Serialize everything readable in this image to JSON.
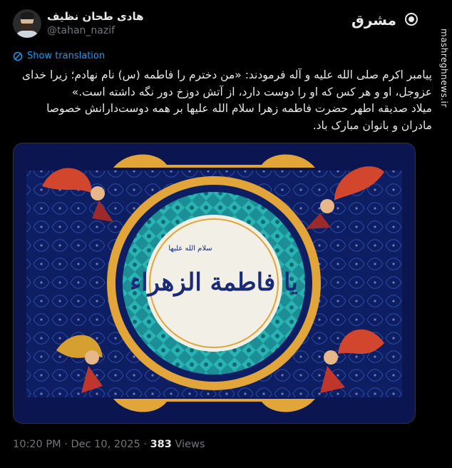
{
  "author": {
    "display_name": "هادی طحان نظیف",
    "username": "@tahan_nazif"
  },
  "header_logo": {
    "label": "مشرق",
    "icon": "mashregh-logo-icon"
  },
  "watermark": {
    "text": "mashreghnews.ir"
  },
  "translate": {
    "label": "Show translation",
    "icon": "translate-icon"
  },
  "tweet": {
    "text": "پیامبر اکرم صلی الله علیه و آله فرمودند: «من دخترم را فاطمه (س) نام نهادم؛ زیرا خدای عزوجل، او و هر کس که او را دوست دارد، از آتش دوزخ دور نگه داشته است.»\nمیلاد صدیقه اطهر حضرت فاطمه زهرا سلام الله علیها بر همه دوست‌دارانش خصوصا مادران و بانوان مبارک باد."
  },
  "media": {
    "description_icon": "ornate-calligraphy-image",
    "calligraphy": "یا فاطمة الزهراء",
    "small_text": "سلام الله علیها",
    "colors": {
      "background": "#0e1e63",
      "gold": "#e1a53a",
      "teal": "#2aa3a8",
      "center": "#f2f0e6",
      "ink": "#1b2a78"
    }
  },
  "meta": {
    "time": "10:20 PM",
    "separator": "·",
    "date": "Dec 10, 2025",
    "views_count": "383",
    "views_label": "Views"
  }
}
